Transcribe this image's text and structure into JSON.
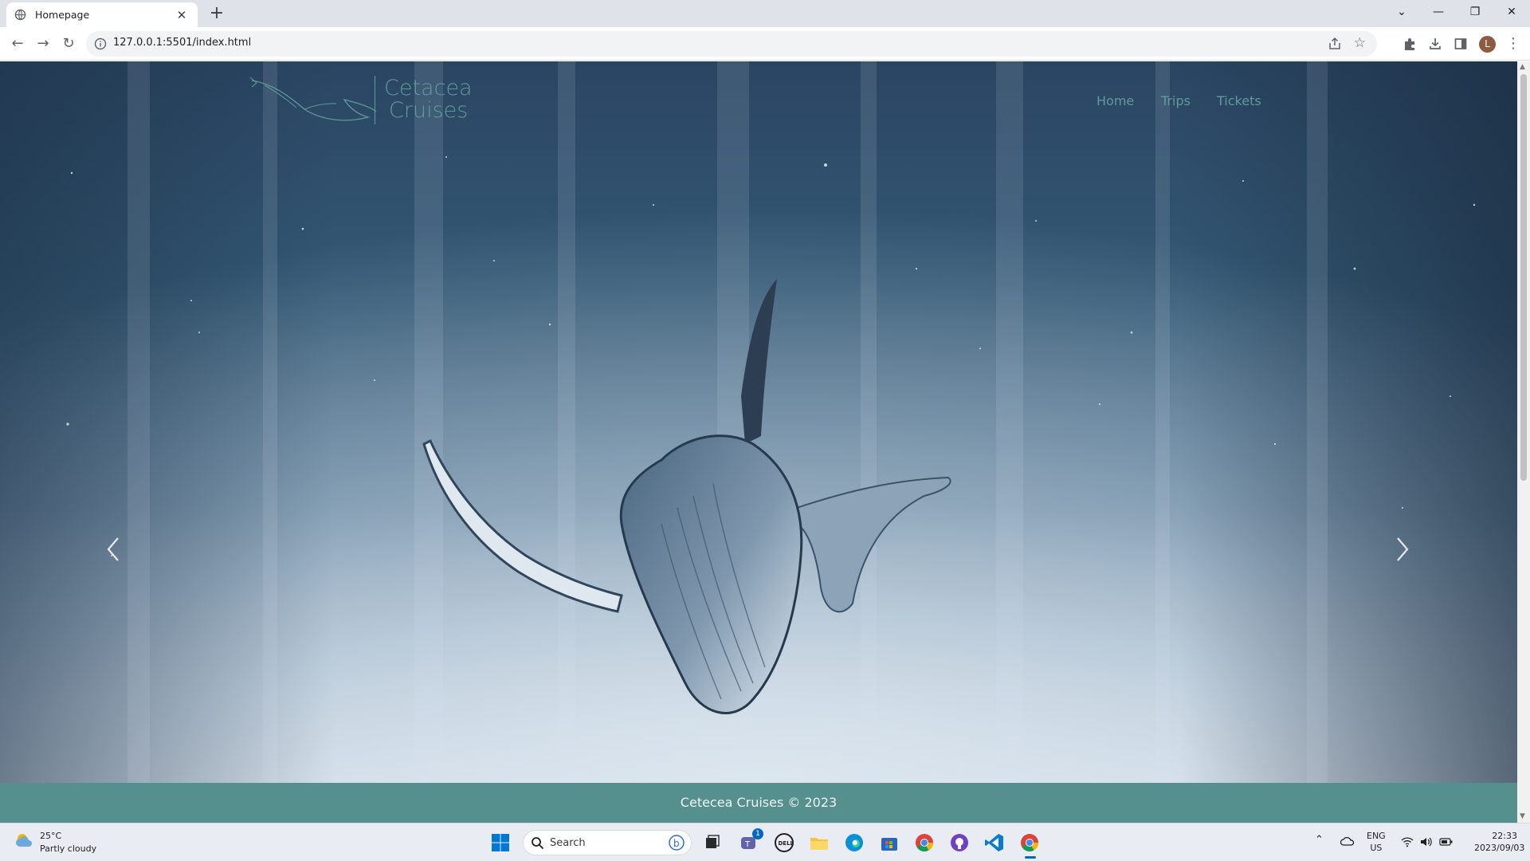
{
  "browser": {
    "tab_title": "Homepage",
    "url": "127.0.0.1:5501/index.html"
  },
  "site": {
    "brand_line1": "Cetacea",
    "brand_line2": "Cruises",
    "nav": [
      "Home",
      "Trips",
      "Tickets"
    ],
    "footer": "Cetecea Cruises © 2023"
  },
  "taskbar": {
    "weather_temp": "25°C",
    "weather_condition": "Partly cloudy",
    "search_placeholder": "Search",
    "teams_badge": "1",
    "lang_line1": "ENG",
    "lang_line2": "US",
    "time": "22:33",
    "date": "2023/09/03"
  },
  "colors": {
    "accent": "#5e9b9a",
    "footer_bg": "#558f8e"
  }
}
